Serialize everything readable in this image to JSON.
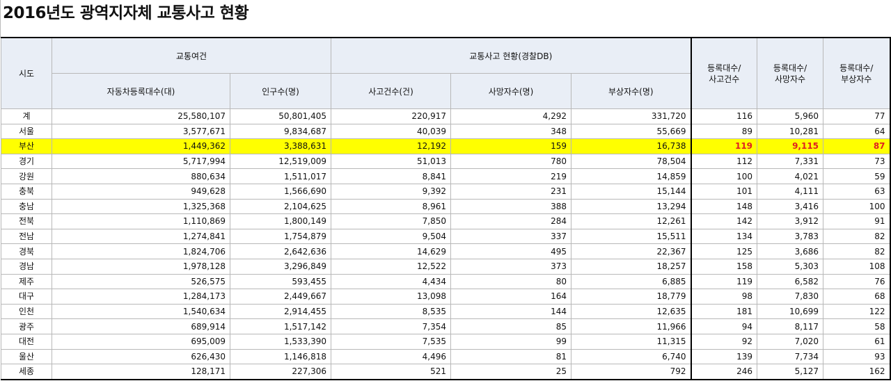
{
  "title": "2016년도 광역지자체 교통사고 현황",
  "headers": {
    "sido": "시도",
    "group_traffic": "교통여건",
    "group_accident": "교통사고 현황(경찰DB)",
    "vehicles": "자동차등록대수(대)",
    "population": "인구수(명)",
    "accidents": "사고건수(건)",
    "deaths": "사망자수(명)",
    "injuries": "부상자수(명)",
    "ratio_accidents_l1": "등록대수/",
    "ratio_accidents_l2": "사고건수",
    "ratio_deaths_l1": "등록대수/",
    "ratio_deaths_l2": "사망자수",
    "ratio_injuries_l1": "등록대수/",
    "ratio_injuries_l2": "부상자수"
  },
  "highlight_color": "#ffff00",
  "highlight_text_color": "#e02020",
  "rows": [
    {
      "sido": "계",
      "vehicles": "25,580,107",
      "population": "50,801,405",
      "accidents": "220,917",
      "deaths": "4,292",
      "injuries": "331,720",
      "r_acc": "116",
      "r_death": "5,960",
      "r_inj": "77"
    },
    {
      "sido": "서울",
      "vehicles": "3,577,671",
      "population": "9,834,687",
      "accidents": "40,039",
      "deaths": "348",
      "injuries": "55,669",
      "r_acc": "89",
      "r_death": "10,281",
      "r_inj": "64"
    },
    {
      "sido": "부산",
      "vehicles": "1,449,362",
      "population": "3,388,631",
      "accidents": "12,192",
      "deaths": "159",
      "injuries": "16,738",
      "r_acc": "119",
      "r_death": "9,115",
      "r_inj": "87",
      "highlight": true
    },
    {
      "sido": "경기",
      "vehicles": "5,717,994",
      "population": "12,519,009",
      "accidents": "51,013",
      "deaths": "780",
      "injuries": "78,504",
      "r_acc": "112",
      "r_death": "7,331",
      "r_inj": "73"
    },
    {
      "sido": "강원",
      "vehicles": "880,634",
      "population": "1,511,017",
      "accidents": "8,841",
      "deaths": "219",
      "injuries": "14,859",
      "r_acc": "100",
      "r_death": "4,021",
      "r_inj": "59"
    },
    {
      "sido": "충북",
      "vehicles": "949,628",
      "population": "1,566,690",
      "accidents": "9,392",
      "deaths": "231",
      "injuries": "15,144",
      "r_acc": "101",
      "r_death": "4,111",
      "r_inj": "63"
    },
    {
      "sido": "충남",
      "vehicles": "1,325,368",
      "population": "2,104,625",
      "accidents": "8,961",
      "deaths": "388",
      "injuries": "13,294",
      "r_acc": "148",
      "r_death": "3,416",
      "r_inj": "100"
    },
    {
      "sido": "전북",
      "vehicles": "1,110,869",
      "population": "1,800,149",
      "accidents": "7,850",
      "deaths": "284",
      "injuries": "12,261",
      "r_acc": "142",
      "r_death": "3,912",
      "r_inj": "91"
    },
    {
      "sido": "전남",
      "vehicles": "1,274,841",
      "population": "1,754,879",
      "accidents": "9,504",
      "deaths": "337",
      "injuries": "15,511",
      "r_acc": "134",
      "r_death": "3,783",
      "r_inj": "82"
    },
    {
      "sido": "경북",
      "vehicles": "1,824,706",
      "population": "2,642,636",
      "accidents": "14,629",
      "deaths": "495",
      "injuries": "22,367",
      "r_acc": "125",
      "r_death": "3,686",
      "r_inj": "82"
    },
    {
      "sido": "경남",
      "vehicles": "1,978,128",
      "population": "3,296,849",
      "accidents": "12,522",
      "deaths": "373",
      "injuries": "18,257",
      "r_acc": "158",
      "r_death": "5,303",
      "r_inj": "108"
    },
    {
      "sido": "제주",
      "vehicles": "526,575",
      "population": "593,455",
      "accidents": "4,434",
      "deaths": "80",
      "injuries": "6,885",
      "r_acc": "119",
      "r_death": "6,582",
      "r_inj": "76"
    },
    {
      "sido": "대구",
      "vehicles": "1,284,173",
      "population": "2,449,667",
      "accidents": "13,098",
      "deaths": "164",
      "injuries": "18,779",
      "r_acc": "98",
      "r_death": "7,830",
      "r_inj": "68"
    },
    {
      "sido": "인천",
      "vehicles": "1,540,634",
      "population": "2,914,455",
      "accidents": "8,535",
      "deaths": "144",
      "injuries": "12,635",
      "r_acc": "181",
      "r_death": "10,699",
      "r_inj": "122"
    },
    {
      "sido": "광주",
      "vehicles": "689,914",
      "population": "1,517,142",
      "accidents": "7,354",
      "deaths": "85",
      "injuries": "11,966",
      "r_acc": "94",
      "r_death": "8,117",
      "r_inj": "58"
    },
    {
      "sido": "대전",
      "vehicles": "695,009",
      "population": "1,533,390",
      "accidents": "7,535",
      "deaths": "99",
      "injuries": "11,315",
      "r_acc": "92",
      "r_death": "7,020",
      "r_inj": "61"
    },
    {
      "sido": "울산",
      "vehicles": "626,430",
      "population": "1,146,818",
      "accidents": "4,496",
      "deaths": "81",
      "injuries": "6,740",
      "r_acc": "139",
      "r_death": "7,734",
      "r_inj": "93"
    },
    {
      "sido": "세종",
      "vehicles": "128,171",
      "population": "227,306",
      "accidents": "521",
      "deaths": "25",
      "injuries": "792",
      "r_acc": "246",
      "r_death": "5,127",
      "r_inj": "162"
    }
  ]
}
